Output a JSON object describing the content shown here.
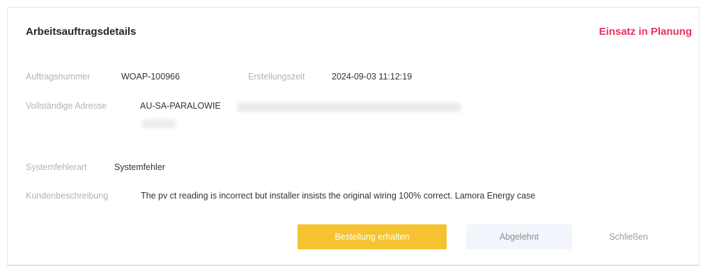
{
  "header": {
    "title": "Arbeitsauftragsdetails",
    "status": "Einsatz in Planung",
    "status_color": "#e8335d"
  },
  "fields": {
    "order_number_label": "Auftragsnummer",
    "order_number_value": "WOAP-100966",
    "created_label": "Erstellungszeit",
    "created_value": "2024-09-03 11:12:19",
    "address_label": "Vollständige Adresse",
    "address_value": "AU-SA-PARALOWIE",
    "error_type_label": "Systemfehlerart",
    "error_type_value": "Systemfehler",
    "customer_desc_label": "Kundenbeschreibung",
    "customer_desc_value": "The pv ct reading is incorrect but installer insists the original wiring 100% correct. Lamora Energy case"
  },
  "actions": {
    "accept_label": "Bestellung erhalten",
    "reject_label": "Abgelehnt",
    "close_label": "Schließen",
    "accept_color": "#f5c332"
  }
}
